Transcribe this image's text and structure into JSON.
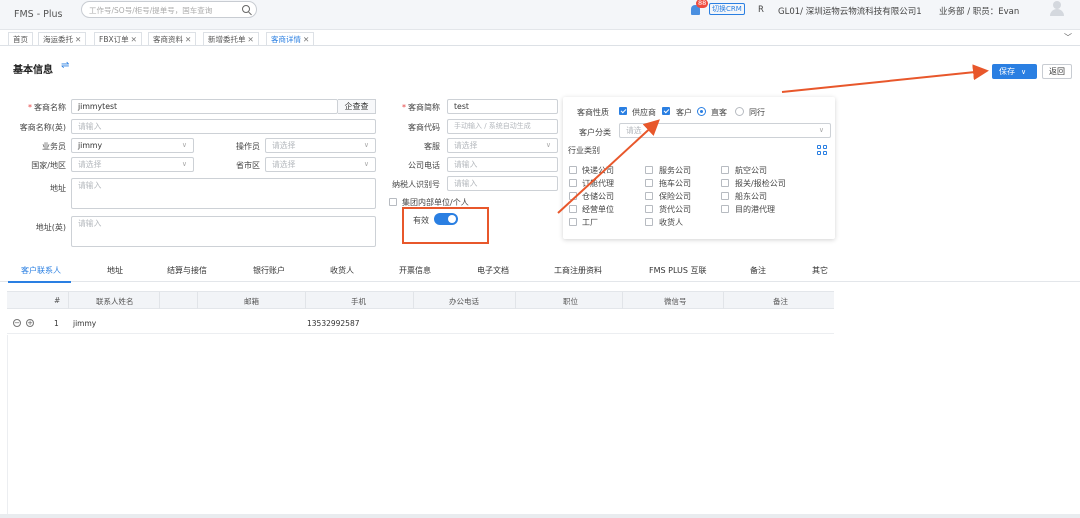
{
  "topbar": {
    "app_title": "FMS - Plus",
    "search_placeholder": "工作号/SO号/柜号/提单号，国车查询",
    "badge_count": "88",
    "crm_label": "切换CRM",
    "user_icon_text": "R",
    "company": "GL01/ 深圳运物云物流科技有限公司1",
    "role": "业务部 / 职员：Evan"
  },
  "tabs": [
    {
      "label": "首页",
      "closable": false
    },
    {
      "label": "海运委托",
      "closable": true
    },
    {
      "label": "FBX订单",
      "closable": true
    },
    {
      "label": "客商资料",
      "closable": true
    },
    {
      "label": "新增委托单",
      "closable": true
    },
    {
      "label": "客商详情",
      "closable": true,
      "active": true
    }
  ],
  "header": {
    "title": "基本信息",
    "save_label": "保存",
    "back_label": "返回"
  },
  "form": {
    "name_label": "客商名称",
    "name_value": "jimmytest",
    "enterprise_check": "企查查",
    "name_en_label": "客商名称(英)",
    "name_en_placeholder": "请输入",
    "salesman_label": "业务员",
    "salesman_value": "jimmy",
    "operator_label": "操作员",
    "operator_placeholder": "请选择",
    "country_label": "国家/地区",
    "country_placeholder": "请选择",
    "province_label": "省市区",
    "province_placeholder": "请选择",
    "address_label": "地址",
    "address_placeholder": "请输入",
    "address_en_label": "地址(英)",
    "address_en_placeholder": "请输入",
    "short_name_label": "客商简称",
    "short_name_value": "test",
    "code_label": "客商代码",
    "code_placeholder": "手动输入 / 系统自动生成",
    "cs_label": "客服",
    "cs_placeholder": "请选择",
    "phone_label": "公司电话",
    "phone_placeholder": "请输入",
    "tax_label": "纳税人识别号",
    "tax_placeholder": "请输入",
    "internal_label": "集团内部单位/个人",
    "valid_label": "有效"
  },
  "panel": {
    "nature_label": "客商性质",
    "supplier": "供应商",
    "customer": "客户",
    "direct": "直客",
    "peer": "同行",
    "category_label": "客户分类",
    "category_placeholder": "请选",
    "industry_label": "行业类别",
    "industry_items": [
      "快递公司",
      "服务公司",
      "航空公司",
      "订舱代理",
      "拖车公司",
      "报关/报检公司",
      "仓储公司",
      "保险公司",
      "船东公司",
      "经营单位",
      "货代公司",
      "目的港代理",
      "工厂",
      "收货人"
    ]
  },
  "subtabs": [
    "客户联系人",
    "地址",
    "结算与接信",
    "银行账户",
    "收货人",
    "开票信息",
    "电子文档",
    "工商注册资料",
    "FMS PLUS 互联",
    "备注",
    "其它"
  ],
  "table": {
    "headers": [
      "#",
      "联系人姓名",
      "",
      "邮箱",
      "手机",
      "办公电话",
      "职位",
      "微信号",
      "备注"
    ],
    "rows": [
      {
        "index": "1",
        "name": "jimmy",
        "email": "",
        "mobile": "13532992587"
      }
    ]
  },
  "colors": {
    "accent": "#2a7fe2",
    "annotation": "#e8572b"
  }
}
